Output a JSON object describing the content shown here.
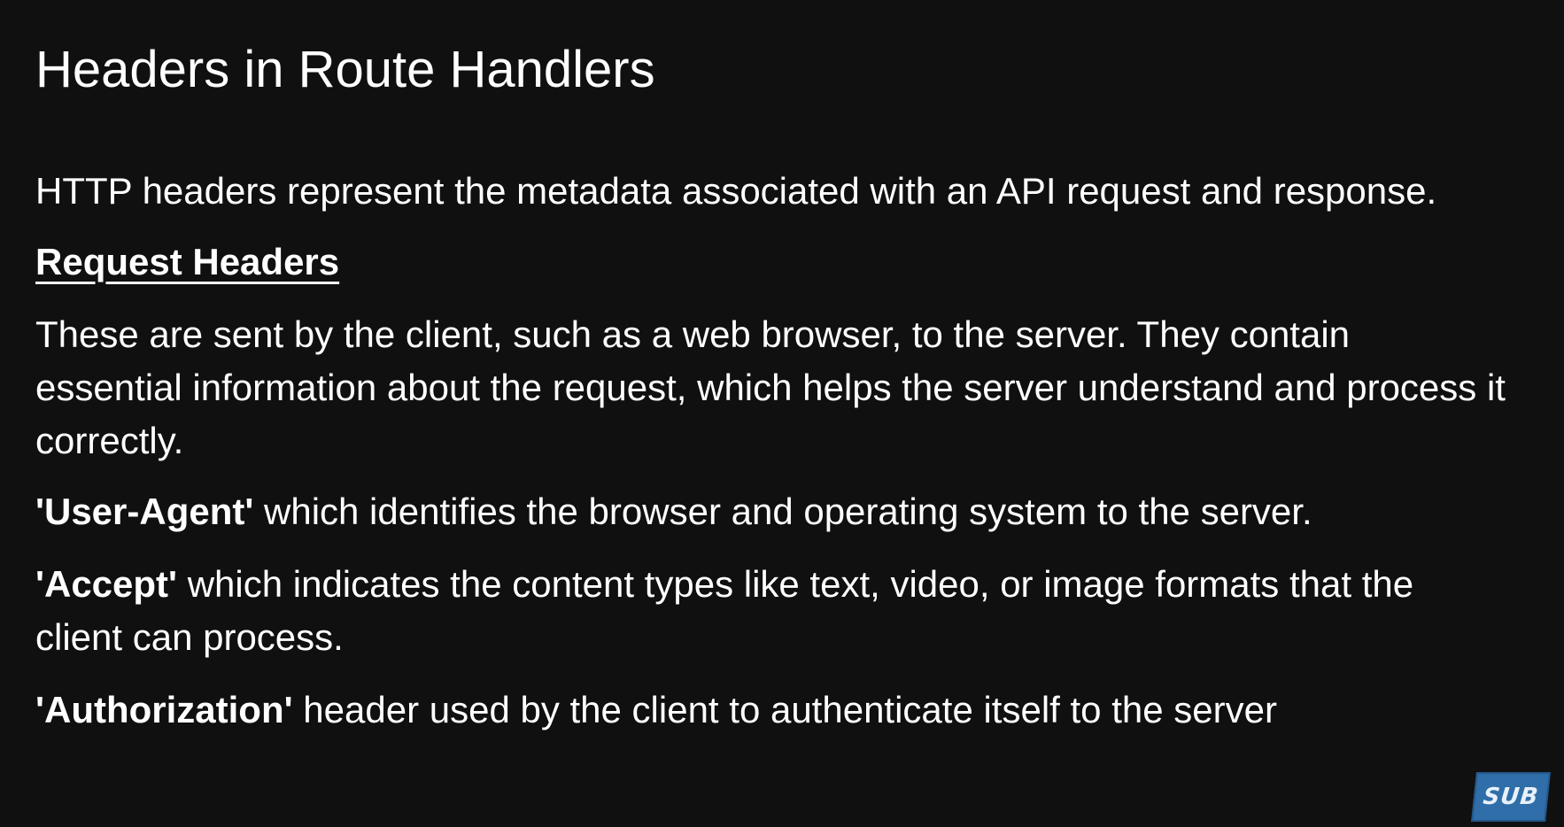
{
  "slide": {
    "title": "Headers in Route Handlers",
    "intro": "HTTP headers represent the metadata associated with an API request and response.",
    "subheading": "Request Headers",
    "description": "These are sent by the client, such as a web browser, to the server. They contain essential information about the request, which helps the server understand and process it correctly.",
    "headers": [
      {
        "name": "'User-Agent'",
        "text": " which identifies the browser and operating system to the server."
      },
      {
        "name": "'Accept'",
        "text": " which indicates the content types like text, video, or image formats that the client can process."
      },
      {
        "name": "'Authorization'",
        "text": " header used by the client to authenticate itself to the server"
      }
    ]
  },
  "badge": {
    "label": "SUB",
    "color": "#2f6ea8"
  }
}
